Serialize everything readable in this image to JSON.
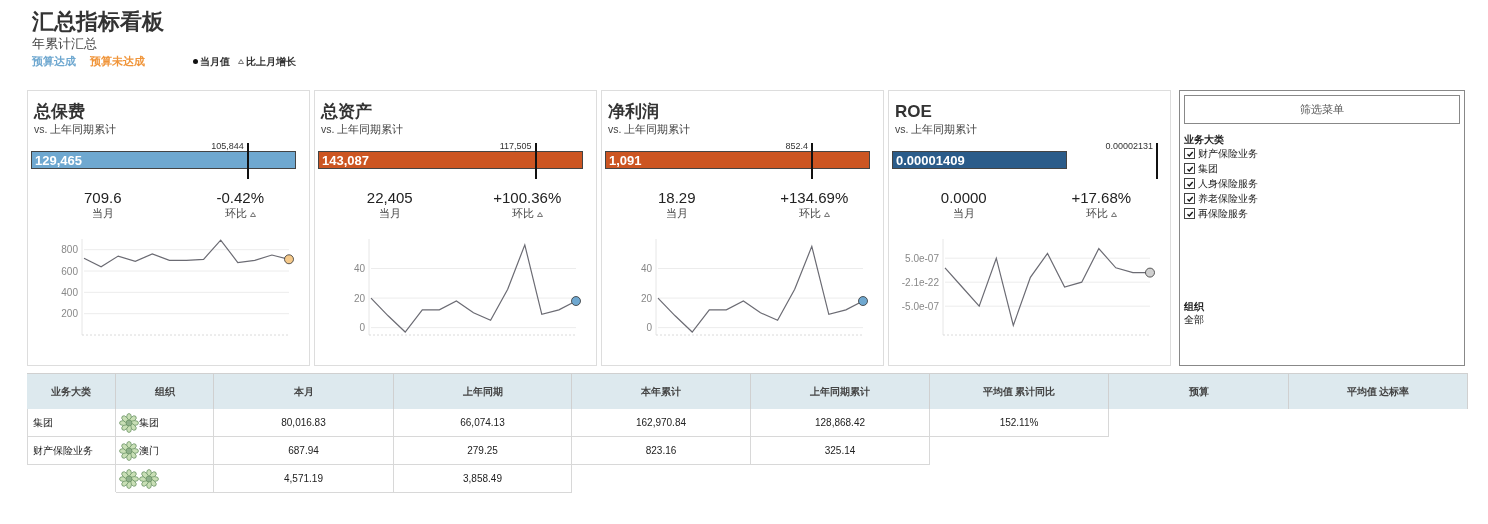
{
  "header": {
    "title": "汇总指标看板",
    "subtitle": "年累计汇总",
    "legend": [
      {
        "label": "预算达成",
        "color": "#6fa8d0",
        "kind": "text"
      },
      {
        "label": "预算未达成",
        "color": "#f0953a",
        "kind": "text"
      },
      {
        "label": "当月值",
        "kind": "dot"
      },
      {
        "label": "比上月增长",
        "kind": "triangle"
      }
    ]
  },
  "cards": [
    {
      "title": "总保费",
      "subtitle": "vs. 上年同期累计",
      "color": "#6fa8d0",
      "current_dot": {
        "color": "#f5c98a"
      },
      "actual": {
        "value": "129,465",
        "level": 1
      },
      "target": {
        "value": "105,844",
        "level": 0.818
      },
      "month": {
        "value": "709.6",
        "label": "当月"
      },
      "change": {
        "value": "-0.42%",
        "label": "环比"
      },
      "chart_data": {
        "type": "line",
        "grid": true,
        "ylim": [
          0,
          900
        ],
        "yticks": [
          200,
          400,
          600,
          800
        ],
        "series": [
          {
            "color": "#6b6b73",
            "values": [
              720,
              640,
              740,
              690,
              760,
              700,
              700,
              710,
              890,
              680,
              700,
              750,
              710
            ]
          }
        ]
      }
    },
    {
      "title": "总资产",
      "subtitle": "vs. 上年同期累计",
      "color": "#cc5522",
      "current_dot": {
        "color": "#6fa8d0"
      },
      "actual": {
        "value": "143,087",
        "level": 1
      },
      "target": {
        "value": "117,505",
        "level": 0.821
      },
      "month": {
        "value": "22,405",
        "label": "当月"
      },
      "change": {
        "value": "+100.36%",
        "label": "环比"
      },
      "chart_data": {
        "type": "line",
        "grid": true,
        "ylim": [
          -5,
          60
        ],
        "yticks": [
          0,
          20,
          40
        ],
        "series": [
          {
            "color": "#6b6b73",
            "values": [
              20,
              8,
              -3,
              12,
              12,
              18,
              10,
              5,
              26,
              56,
              9,
              12,
              18
            ]
          }
        ]
      }
    },
    {
      "title": "净利润",
      "subtitle": "vs. 上年同期累计",
      "color": "#cc5522",
      "current_dot": {
        "color": "#6fa8d0"
      },
      "actual": {
        "value": "1,091",
        "level": 1
      },
      "target": {
        "value": "852.4",
        "level": 0.781
      },
      "month": {
        "value": "18.29",
        "label": "当月"
      },
      "change": {
        "value": "+134.69%",
        "label": "环比"
      },
      "chart_data": {
        "type": "line",
        "grid": true,
        "ylim": [
          -5,
          60
        ],
        "yticks": [
          0,
          20,
          40
        ],
        "series": [
          {
            "color": "#6b6b73",
            "values": [
              20,
              8,
              -3,
              12,
              12,
              18,
              10,
              5,
              26,
              55,
              9,
              12,
              18
            ]
          }
        ]
      }
    },
    {
      "title": "ROE",
      "subtitle": "vs. 上年同期累计",
      "color": "#2b5c8a",
      "current_dot": {
        "color": "#d0d0d0"
      },
      "actual": {
        "value": "0.00001409",
        "level": 0.661
      },
      "target": {
        "value": "0.00002131",
        "level": 1
      },
      "month": {
        "value": "0.0000",
        "label": "当月"
      },
      "change": {
        "value": "+17.68%",
        "label": "环比"
      },
      "chart_data": {
        "type": "line",
        "grid": true,
        "ylim": [
          -1.1e-06,
          9e-07
        ],
        "yticks": [
          {
            "value": 5e-07,
            "label": "5.0e-07"
          },
          {
            "value": 0,
            "label": "-2.1e-22"
          },
          {
            "value": -5e-07,
            "label": "-5.0e-07"
          }
        ],
        "series": [
          {
            "color": "#6b6b73",
            "values": [
              3e-07,
              -1e-07,
              -5e-07,
              5e-07,
              -9e-07,
              1e-07,
              6e-07,
              -1e-07,
              0,
              7e-07,
              3e-07,
              2e-07,
              2e-07
            ]
          }
        ]
      }
    }
  ],
  "filter_panel": {
    "button": "筛选菜单",
    "groups": [
      {
        "label": "业务大类",
        "kind": "checklist",
        "items": [
          {
            "label": "财产保险业务",
            "checked": true
          },
          {
            "label": "集团",
            "checked": true
          },
          {
            "label": "人身保险服务",
            "checked": true
          },
          {
            "label": "养老保险业务",
            "checked": true
          },
          {
            "label": "再保险服务",
            "checked": true
          }
        ]
      },
      {
        "label": "组织",
        "kind": "value",
        "value": "全部"
      }
    ]
  },
  "table": {
    "columns": [
      "业务大类",
      "组织",
      "本月",
      "上年同期",
      "本年累计",
      "上年同期累计",
      "平均值 累计同比",
      "预算",
      "平均值 达标率"
    ],
    "rows": [
      {
        "category": "集团",
        "org": "集团",
        "org_icons": [
          {
            "kind": "flower"
          }
        ],
        "values": [
          "80,016.83",
          "66,074.13",
          "162,970.84",
          "128,868.42",
          "152.11%"
        ]
      },
      {
        "category": "财产保险业务",
        "org": "澳门",
        "org_icons": [
          {
            "kind": "flower"
          }
        ],
        "values": [
          "687.94",
          "279.25",
          "823.16",
          "325.14"
        ]
      },
      {
        "org_icons": [
          {
            "kind": "flower"
          },
          {
            "kind": "flower"
          }
        ],
        "values": [
          "4,571.19",
          "3,858.49"
        ]
      }
    ]
  }
}
